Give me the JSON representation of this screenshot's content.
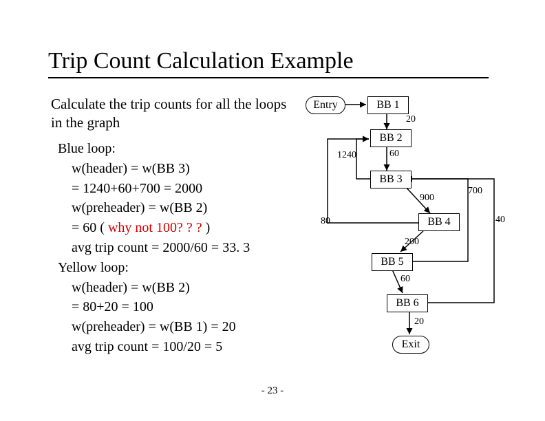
{
  "title": "Trip Count Calculation Example",
  "subtitle": "Calculate the trip counts for all the loops in the graph",
  "body": {
    "l1": "Blue loop:",
    "l2": "    w(header) = w(BB 3)",
    "l3": "    = 1240+60+700 = 2000",
    "l4": "    w(preheader) = w(BB 2)",
    "l5": "    = 60 ( ",
    "l5r": "why not 100? ? ?",
    "l5b": " )",
    "l6": "    avg trip count = 2000/60 = 33. 3",
    "l7": "Yellow loop:",
    "l8": "    w(header) = w(BB 2)",
    "l9": "    = 80+20 = 100",
    "l10": "    w(preheader) = w(BB 1) = 20",
    "l11": "    avg trip count = 100/20 = 5"
  },
  "footer": "- 23 -",
  "nodes": {
    "entry": "Entry",
    "bb1": "BB 1",
    "bb2": "BB 2",
    "bb3": "BB 3",
    "bb4": "BB 4",
    "bb5": "BB 5",
    "bb6": "BB 6",
    "exit": "Exit"
  },
  "edges": {
    "e_bb1_bb2": "20",
    "e_bb2_bb3": "60",
    "e_bb3_bb4": "900",
    "e_bb4_bb5": "200",
    "e_bb5_bb6": "60",
    "e_bb6_exit": "20",
    "e_bb3_bb2_back": "1240",
    "e_bb4_bb2_back": "80",
    "e_bb5_bb3_back": "700",
    "e_bb6_bb3_back": "40"
  }
}
